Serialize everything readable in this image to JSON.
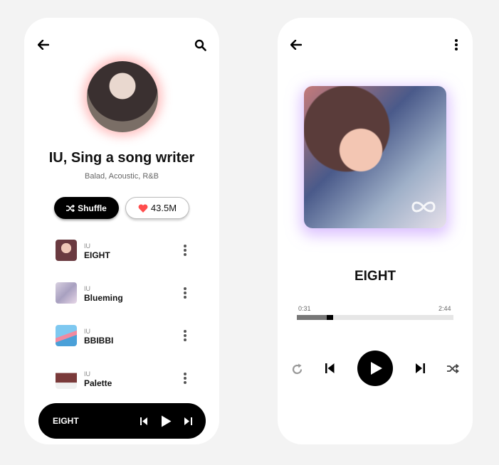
{
  "artist_screen": {
    "artist_name": "IU, Sing a song writer",
    "genres": "Balad, Acoustic, R&B",
    "shuffle_label": "Shuffle",
    "likes": "43.5M",
    "tracks": [
      {
        "artist": "IU",
        "title": "EIGHT"
      },
      {
        "artist": "IU",
        "title": "Blueming"
      },
      {
        "artist": "IU",
        "title": "BBIBBI"
      },
      {
        "artist": "IU",
        "title": "Palette"
      }
    ],
    "mini_player": {
      "now_playing": "EIGHT"
    }
  },
  "player_screen": {
    "song_title": "EIGHT",
    "elapsed": "0:31",
    "duration": "2:44",
    "progress": 0.19
  },
  "colors": {
    "accent": "#000000",
    "like": "#ff4d4d",
    "background": "#f3f3f3"
  }
}
